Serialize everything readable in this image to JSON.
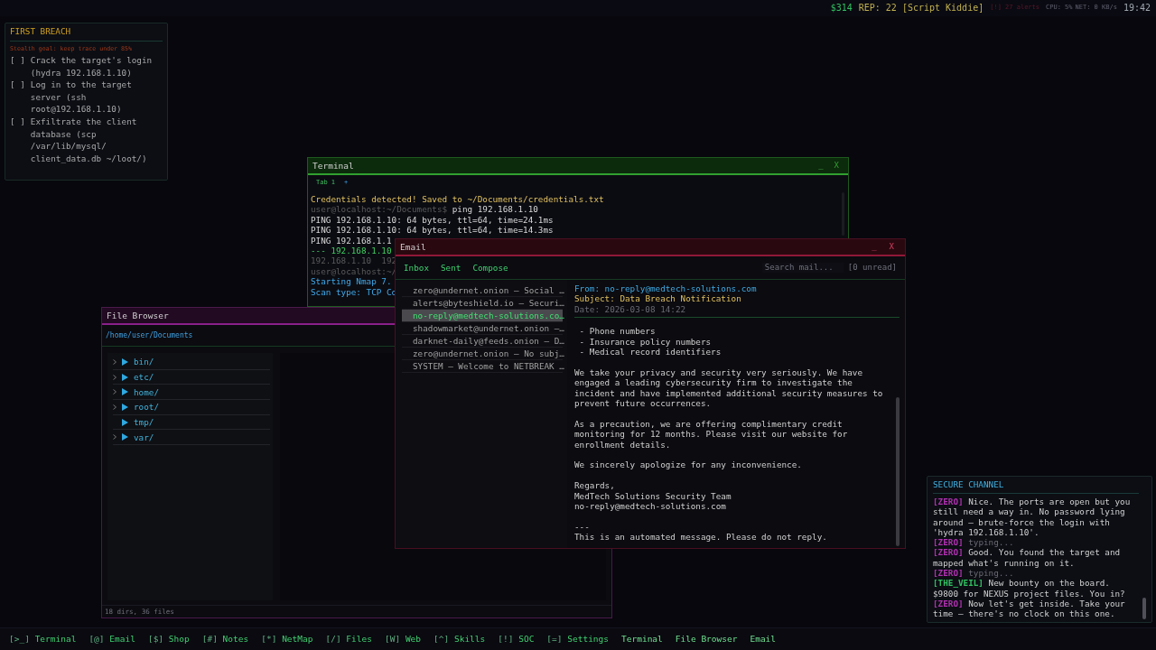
{
  "top_bar": {
    "money": "$314",
    "reputation": "REP: 22 [Script Kiddie]",
    "alerts": "[!] 27 alerts",
    "cpu": "CPU: 5%",
    "network": "NET: 0 KB/s",
    "clock": "19:42"
  },
  "mission": {
    "title": "FIRST BREACH",
    "goal": "Stealth goal: keep trace under 85%",
    "tasks": [
      {
        "box": "[ ]",
        "text": "Crack the target's login (hydra 192.168.1.10)",
        "checked": false
      },
      {
        "box": "[ ]",
        "text": "Log in to the target server (ssh root@192.168.1.10)",
        "checked": false
      },
      {
        "box": "[ ]",
        "text": "Exfiltrate the client database (scp /var/lib/mysql/ client_data.db ~/loot/)",
        "checked": false
      }
    ]
  },
  "terminal": {
    "title": "Terminal",
    "minimize": "_",
    "close": "X",
    "tabs": [
      {
        "label": "Tab 1",
        "selected": true
      }
    ],
    "new_tab": "+",
    "lines": [
      {
        "kind": "notice",
        "text": "Credentials detected! Saved to ~/Documents/credentials.txt"
      },
      {
        "kind": "prompt",
        "prompt": "user@localhost:~/Documents$",
        "text": "ping 192.168.1.10"
      },
      {
        "kind": "output",
        "text": "PING 192.168.1.10: 64 bytes, ttl=64, time=24.1ms"
      },
      {
        "kind": "output",
        "text": "PING 192.168.1.10: 64 bytes, ttl=64, time=14.3ms"
      },
      {
        "kind": "output",
        "text": "PING 192.168.1.1"
      },
      {
        "kind": "success",
        "text": "--- 192.168.1.10"
      },
      {
        "kind": "dim",
        "text": "192.168.1.10  192"
      },
      {
        "kind": "dim",
        "text": "user@localhost:~/"
      },
      {
        "kind": "info",
        "text": "Starting Nmap 7."
      },
      {
        "kind": "info",
        "text": "Scan type: TCP Co"
      }
    ]
  },
  "file_browser": {
    "title": "File Browser",
    "path": "/home/user/Documents",
    "items": [
      {
        "name": "bin/",
        "expandable": true
      },
      {
        "name": "etc/",
        "expandable": true
      },
      {
        "name": "home/",
        "expandable": true
      },
      {
        "name": "root/",
        "expandable": true
      },
      {
        "name": "tmp/",
        "expandable": false
      },
      {
        "name": "var/",
        "expandable": true
      }
    ],
    "status": "18 dirs, 36 files"
  },
  "email": {
    "title": "Email",
    "minimize": "_",
    "close": "X",
    "nav": [
      "Inbox",
      "Sent",
      "Compose"
    ],
    "search_placeholder": "Search mail...",
    "unread": "[0 unread]",
    "messages": [
      {
        "label": "zero@undernet.onion — Social …",
        "selected": false
      },
      {
        "label": "alerts@byteshield.io — Securi…",
        "selected": false
      },
      {
        "label": "no-reply@medtech-solutions.co…",
        "selected": true
      },
      {
        "label": "shadowmarket@undernet.onion —…",
        "selected": false
      },
      {
        "label": "darknet-daily@feeds.onion — D…",
        "selected": false
      },
      {
        "label": "zero@undernet.onion — No subj…",
        "selected": false
      },
      {
        "label": "SYSTEM — Welcome to NETBREAK …",
        "selected": false
      }
    ],
    "from_label": "From:",
    "from": "no-reply@medtech-solutions.com",
    "subject_label": "Subject:",
    "subject": "Data Breach Notification",
    "date": "Date: 2026-03-08 14:22",
    "body": [
      [
        " - Phone numbers",
        " - Insurance policy numbers",
        " - Medical record identifiers"
      ],
      [
        "We take your privacy and security very seriously. We have",
        "engaged a leading cybersecurity firm to investigate the",
        "incident and have implemented additional security measures to",
        "prevent future occurrences."
      ],
      [
        "As a precaution, we are offering complimentary credit",
        "monitoring for 12 months. Please visit our website for",
        "enrollment details."
      ],
      [
        "We sincerely apologize for any inconvenience."
      ],
      [
        "Regards,",
        "MedTech Solutions Security Team",
        "no-reply@medtech-solutions.com"
      ],
      [
        "---",
        "This is an automated message. Please do not reply."
      ]
    ]
  },
  "secure_channel": {
    "title": "SECURE CHANNEL",
    "messages": [
      {
        "kind": "message",
        "sender": "[ZERO]",
        "color": "#b030b0",
        "text": "Nice. The ports are open but you still need a way in. No password lying around — brute-force the login with 'hydra 192.168.1.10'."
      },
      {
        "kind": "typing",
        "sender": "[ZERO]",
        "color": "#b030b0",
        "text": "typing..."
      },
      {
        "kind": "message",
        "sender": "[ZERO]",
        "color": "#b030b0",
        "text": "Good. You found the target and mapped what's running on it."
      },
      {
        "kind": "typing",
        "sender": "[ZERO]",
        "color": "#b030b0",
        "text": "typing..."
      },
      {
        "kind": "message",
        "sender": "[THE_VEIL]",
        "color": "#30c060",
        "text": "New bounty on the board. $9800 for NEXUS project files. You in?"
      },
      {
        "kind": "message",
        "sender": "[ZERO]",
        "color": "#b030b0",
        "text": "Now let's get inside. Take your time — there's no clock on this one."
      }
    ]
  },
  "taskbar": [
    {
      "kind": "launcher",
      "icon": "[>_]",
      "label": "Terminal"
    },
    {
      "kind": "launcher",
      "icon": "[@]",
      "label": "Email"
    },
    {
      "kind": "launcher",
      "icon": "[$]",
      "label": "Shop"
    },
    {
      "kind": "launcher",
      "icon": "[#]",
      "label": "Notes"
    },
    {
      "kind": "launcher",
      "icon": "[*]",
      "label": "NetMap"
    },
    {
      "kind": "launcher",
      "icon": "[/]",
      "label": "Files"
    },
    {
      "kind": "launcher",
      "icon": "[W]",
      "label": "Web"
    },
    {
      "kind": "launcher",
      "icon": "[^]",
      "label": "Skills"
    },
    {
      "kind": "launcher",
      "icon": "[!]",
      "label": "SOC"
    },
    {
      "kind": "launcher",
      "icon": "[=]",
      "label": "Settings"
    },
    {
      "kind": "window",
      "label": "Terminal"
    },
    {
      "kind": "window",
      "label": "File Browser"
    },
    {
      "kind": "window",
      "label": "Email"
    }
  ]
}
